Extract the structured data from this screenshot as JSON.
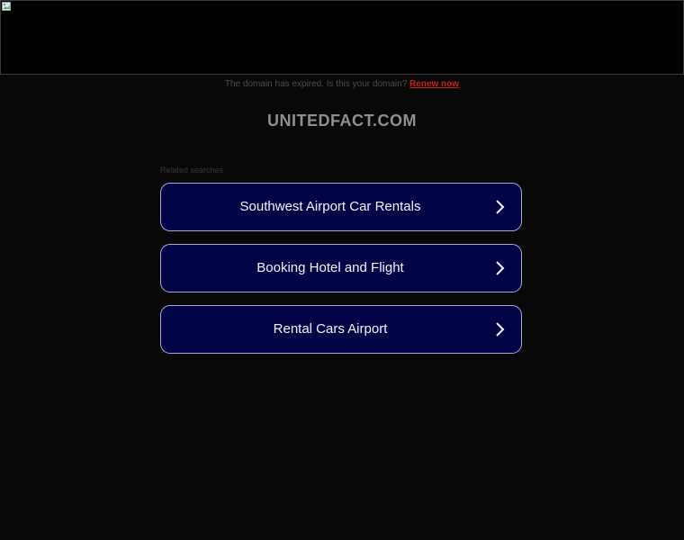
{
  "notice": {
    "text": "The domain has expired. Is this your domain?",
    "link_label": "Renew now"
  },
  "domain_title": "UNITEDFACT.COM",
  "related": {
    "heading": "Related searches",
    "items": [
      {
        "label": "Southwest Airport Car Rentals"
      },
      {
        "label": "Booking Hotel and Flight"
      },
      {
        "label": "Rental Cars Airport"
      }
    ]
  },
  "colors": {
    "button_bg": "#030446",
    "button_border": "#a9a9d9",
    "renew_link": "#c82016",
    "page_bg": "#080808"
  },
  "icons": {
    "broken_image": "broken-image-icon",
    "chevron": "chevron-right-icon"
  }
}
